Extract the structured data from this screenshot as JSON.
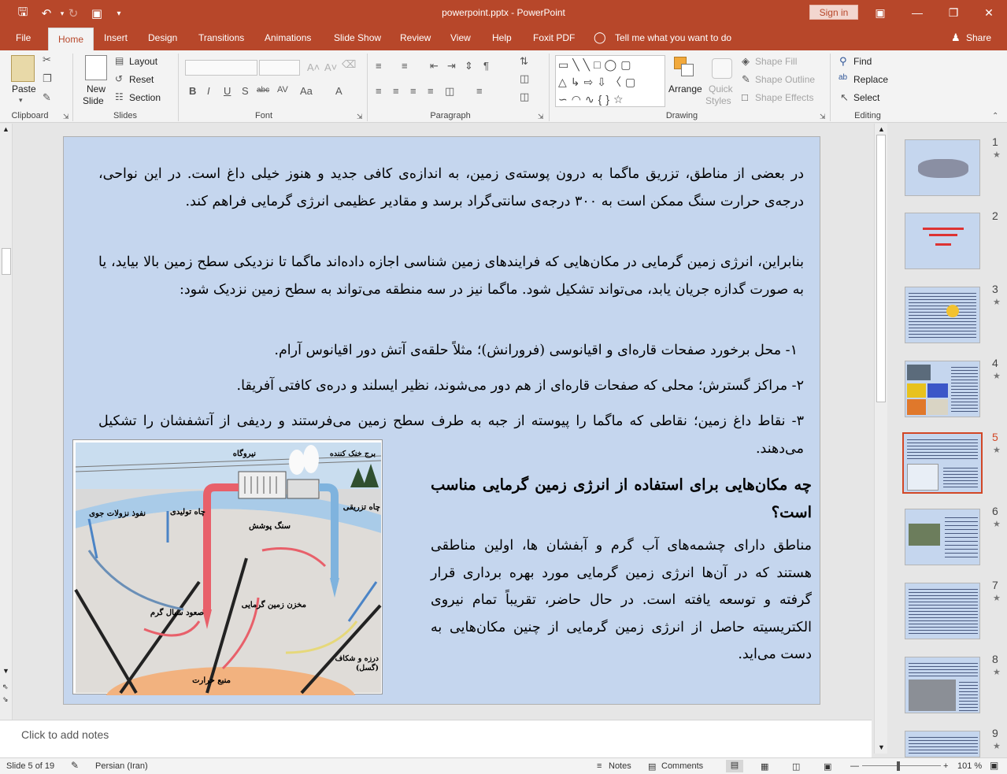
{
  "app": {
    "title": "powerpoint.pptx  -  PowerPoint",
    "sign_in": "Sign in",
    "share": "Share",
    "tell_me": "Tell me what you want to do"
  },
  "tabs": [
    "File",
    "Home",
    "Insert",
    "Design",
    "Transitions",
    "Animations",
    "Slide Show",
    "Review",
    "View",
    "Help",
    "Foxit PDF"
  ],
  "active_tab": "Home",
  "ribbon": {
    "clipboard": {
      "label": "Clipboard",
      "paste": "Paste"
    },
    "slides": {
      "label": "Slides",
      "new_slide_1": "New",
      "new_slide_2": "Slide",
      "layout": "Layout",
      "reset": "Reset",
      "section": "Section"
    },
    "font": {
      "label": "Font"
    },
    "paragraph": {
      "label": "Paragraph"
    },
    "drawing": {
      "label": "Drawing",
      "arrange": "Arrange",
      "quick_styles_1": "Quick",
      "quick_styles_2": "Styles",
      "shape_fill": "Shape Fill",
      "shape_outline": "Shape Outline",
      "shape_effects": "Shape Effects"
    },
    "editing": {
      "label": "Editing",
      "find": "Find",
      "replace": "Replace",
      "select": "Select"
    }
  },
  "slide": {
    "p1": "در بعضی از مناطق، تزریق ماگما به درون پوسته‌ی زمین، به اندازه‌ی کافی جدید و هنوز خیلی داغ است. در این نواحی، درجه‌ی حرارت سنگ ممکن است به ۳۰۰ درجه‌ی سانتی‌گراد برسد و مقادیر عظیمی انرژی گرمایی فراهم کند.",
    "p2": "بنابراین، انرژی زمین گرمایی در مکان‌هایی که فرایندهای زمین شناسی اجازه داده‌اند ماگما تا نزدیکی سطح زمین بالا بیاید، یا به صورت گدازه جریان یابد، می‌تواند تشکیل شود. ماگما نیز در سه منطقه می‌تواند به سطح زمین نزدیک شود:",
    "l1": "۱-  محل برخورد صفحات قاره‌ای و اقیانوسی (فرورانش)؛ مثلاً حلقه‌ی آتش دور اقیانوس آرام.",
    "l2": "۲- مراکز گسترش؛ محلی که صفحات قاره‌ای از هم دور می‌شوند، نظیر ایسلند و دره‌ی کافتی آفریقا.",
    "l3": "۳- نقاط داغ زمین؛ نقاطی که ماگما را پیوسته از جبه به طرف سطح زمین می‌فرستند و ردیفی از آتشفشان را تشکیل می‌دهند.",
    "heading": "چه مکان‌هایی برای استفاده از انرژی زمین گرمایی مناسب است؟",
    "p3": "مناطق دارای چشمه‌های آب گرم و آبفشان ها، اولین مناطقی هستند که در آن‌ها انرژی زمین گرمایی مورد بهره برداری قرار گرفته و توسعه یافته است. در حال حاضر، تقریباً تمام نیروی الکتریسیته حاصل از انرژی زمین گرمایی از چنین مکان‌هایی به دست می‌اید.",
    "diagram": {
      "power_plant": "نیروگاه",
      "cooling_tower": "برج خنک کننده",
      "injection_well": "چاه تزریقی",
      "production_well": "چاه تولیدی",
      "rainfall": "نفوذ نزولات جوی",
      "cap_rock": "سنگ پوشش",
      "reservoir": "مخزن زمین گرمایی",
      "hot_fluid": "صعود سیال گرم",
      "fault": "درزه و شکاف (گسل)",
      "heat_source": "منبع حرارت"
    }
  },
  "notes": {
    "placeholder": "Click to add notes"
  },
  "thumbnails": [
    "1",
    "2",
    "3",
    "4",
    "5",
    "6",
    "7",
    "8",
    "9"
  ],
  "selected_slide": "5",
  "status": {
    "slide_info": "Slide 5 of 19",
    "language": "Persian (Iran)",
    "notes": "Notes",
    "comments": "Comments",
    "zoom": "101 %"
  },
  "colors": {
    "accent": "#b7472a",
    "slide_bg": "#c5d6ee",
    "selected_thumb": "#d24726"
  }
}
